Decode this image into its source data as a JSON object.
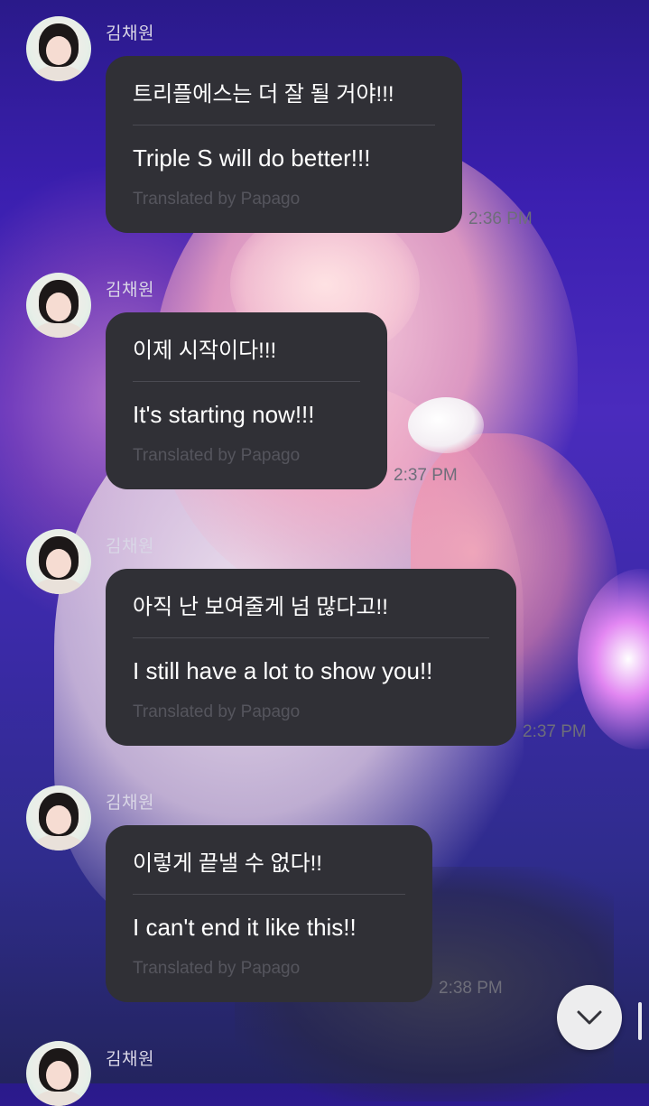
{
  "chat": {
    "messages": [
      {
        "sender": "김채원",
        "korean": "트리플에스는 더 잘 될 거야!!!",
        "english": "Triple S will do better!!!",
        "translation_note": "Translated by Papago",
        "time": "2:36 PM"
      },
      {
        "sender": "김채원",
        "korean": "이제 시작이다!!!",
        "english": "It's starting now!!!",
        "translation_note": "Translated by Papago",
        "time": "2:37 PM"
      },
      {
        "sender": "김채원",
        "korean": "아직 난 보여줄게 넘 많다고!!",
        "english": "I still have a lot to show you!!",
        "translation_note": "Translated by Papago",
        "time": "2:37 PM"
      },
      {
        "sender": "김채원",
        "korean": "이렇게 끝낼 수 없다!!",
        "english": "I can't end it like this!!",
        "translation_note": "Translated by Papago",
        "time": "2:38 PM"
      },
      {
        "sender": "김채원"
      }
    ]
  },
  "scroll_button": {
    "icon": "chevron-down-icon"
  },
  "colors": {
    "bubble": "#303036",
    "bubble_text": "#ffffff",
    "translation_text": "#55555d",
    "time_text": "#6e6e7a"
  }
}
